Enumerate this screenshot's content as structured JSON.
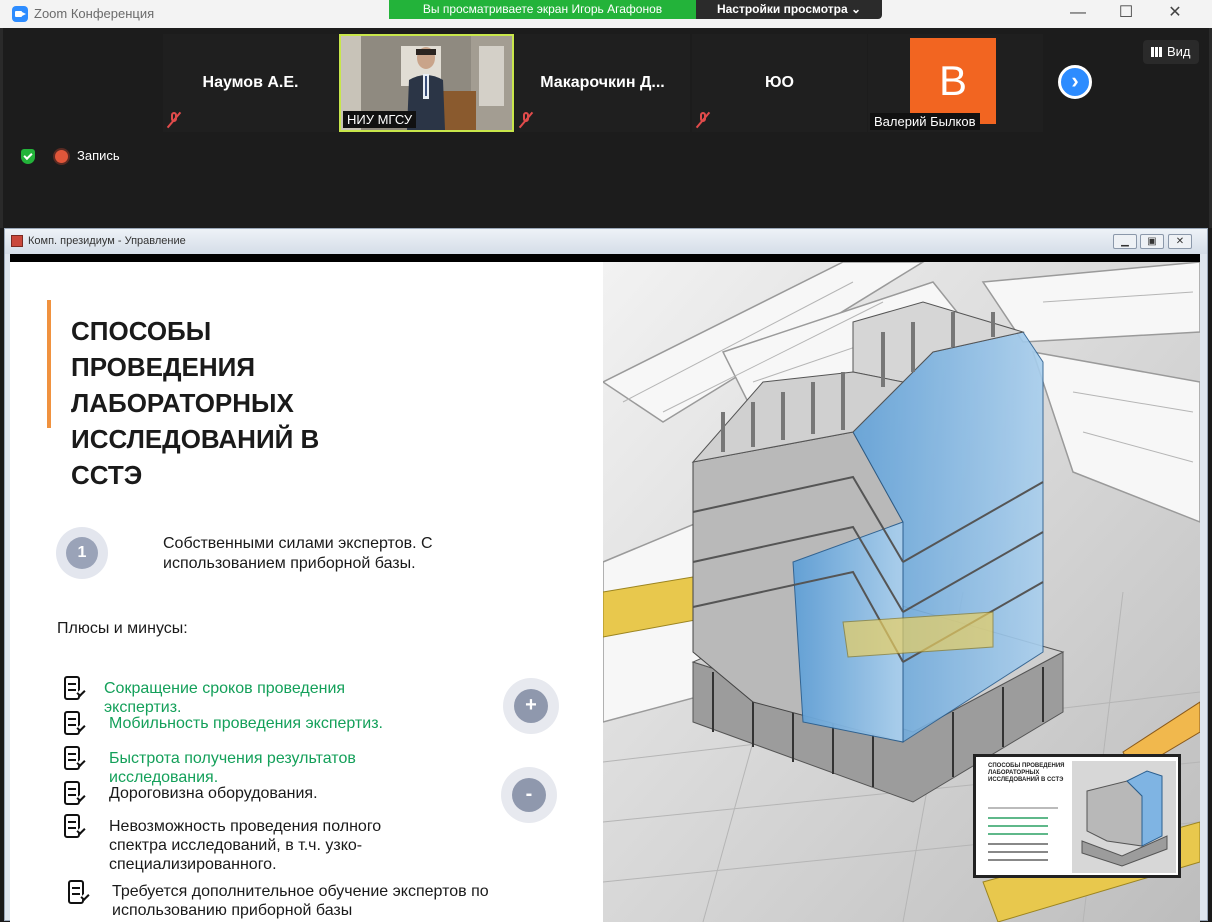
{
  "window": {
    "app_title": "Zoom Конференция",
    "share_banner": "Вы просматриваете экран Игорь Агафонов",
    "view_settings": "Настройки просмотра"
  },
  "participants": [
    {
      "name": "Наумов А.Е.",
      "muted": true
    },
    {
      "caption": "НИУ МГСУ",
      "video": true
    },
    {
      "name": "Макарочкин Д...",
      "muted": true
    },
    {
      "name": "ЮО",
      "muted": true
    },
    {
      "avatar_letter": "В",
      "caption": "Валерий Былков",
      "avatar_color": "#f26521"
    }
  ],
  "controls": {
    "view_label": "Вид",
    "recording_label": "Запись"
  },
  "inner_window": {
    "title": "Комп. президиум - Управление"
  },
  "slide": {
    "title": "СПОСОБЫ ПРОВЕДЕНИЯ ЛАБОРАТОРНЫХ ИССЛЕДОВАНИЙ В ССТЭ",
    "method_number": "1",
    "method_text": "Собственными силами экспертов. С использованием приборной базы.",
    "pros_cons_label": "Плюсы и минусы:",
    "pros": [
      "Сокращение сроков проведения экспертиз.",
      "Мобильность проведения экспертиз.",
      "Быстрота получения результатов исследования."
    ],
    "cons": [
      "Дороговизна оборудования.",
      "Невозможность проведения полного спектра исследований, в т.ч. узко-специализированного.",
      "Требуется дополнительное обучение экспертов по использованию приборной базы"
    ],
    "plus_sign": "+",
    "minus_sign": "-"
  },
  "thumbnail": {
    "title": "СПОСОБЫ ПРОВЕДЕНИЯ ЛАБОРАТОРНЫХ ИССЛЕДОВАНИЙ В ССТЭ"
  },
  "colors": {
    "accent_orange": "#f0923f",
    "pros_green": "#14a05a",
    "share_green": "#23b33a",
    "zoom_blue": "#2d8cff"
  }
}
